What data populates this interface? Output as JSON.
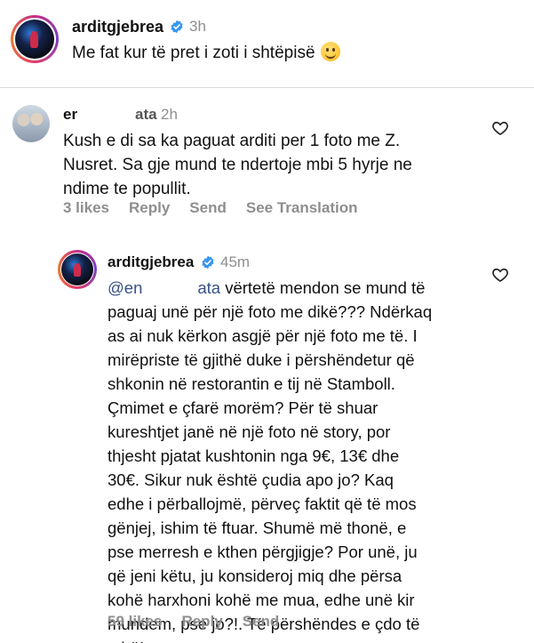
{
  "caption": {
    "username": "arditgjebrea",
    "time": "3h",
    "text": "Me fat kur të pret i zoti i shtëpisë",
    "emoji": "smiling-face-icon"
  },
  "comment1": {
    "username_start": "er",
    "username_end": "ata",
    "time": "2h",
    "text": "Kush e di sa ka paguat arditi per 1 foto me Z. Nusret. Sa gje mund te ndertoje mbi 5 hyrje ne ndime te popullit.",
    "line1": "Kush e di sa ka paguat arditi per 1 foto me Z.",
    "line2": "Nusret. Sa gje mund te ndertoje mbi 5 hyrje ne",
    "line3": "ndime te popullit.",
    "likes": "3 likes",
    "reply": "Reply",
    "send": "Send",
    "see_translation": "See Translation"
  },
  "reply1": {
    "username": "arditgjebrea",
    "time": "45m",
    "mention_start": "@en",
    "mention_end": "ata",
    "lines": [
      " vërtetë mendon se mund të",
      "paguaj unë për një foto me dikë??? Ndërkaq",
      "as ai nuk kërkon asgjë për një foto me të. I",
      "mirëpriste të gjithë duke i përshëndetur që",
      "shkonin në restorantin e tij në Stamboll.",
      "Çmimet e çfarë morëm? Për të shuar",
      "kureshtjet janë në një foto në story, por",
      "thjesht pjatat kushtonin nga 9€, 13€ dhe",
      "30€. Sikur nuk është çudia apo jo? Kaq",
      "edhe i përballojmë, përveç faktit që të mos",
      "gënjej, ishim të ftuar. Shumë më thonë, e",
      "pse merresh e kthen përgjigje? Por unë, ju",
      "që jeni këtu, ju konsideroj miq dhe përsa",
      "kohë harxhoni kohë me mua, edhe unë kir",
      "mundem, pse jo?!. Të përshëndes e çdo të",
      "mirë!"
    ],
    "likes": "59 likes",
    "reply": "Reply",
    "send": "Send"
  },
  "colors": {
    "text": "#111111",
    "muted": "#8e8e8e",
    "verified": "#3897f0",
    "mention": "#385185"
  }
}
